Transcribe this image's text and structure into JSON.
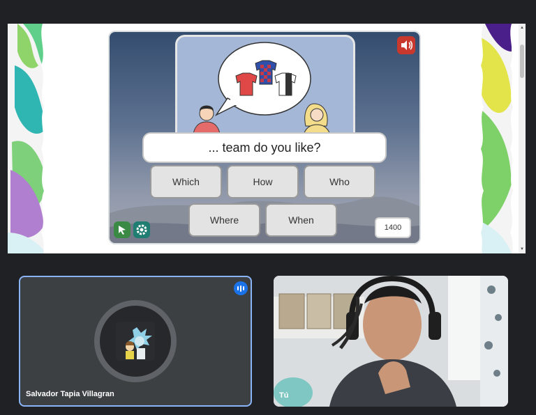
{
  "game": {
    "sentence": "... team do you like?",
    "options": [
      "Which",
      "How",
      "Who",
      "Where",
      "When"
    ],
    "score": "1400"
  },
  "participants": [
    {
      "name": "Salvador Tapia Villagran"
    },
    {
      "name": "Tú"
    }
  ],
  "icons": {
    "sound": "speaker-icon",
    "home": "home-icon",
    "settings": "gear-icon",
    "speaking": "audio-level-icon"
  },
  "colors": {
    "background": "#202124",
    "tile": "#3c4043",
    "active_border": "#8ab4f8",
    "speaking_badge": "#1a73e8",
    "sound_button": "#c9382c"
  }
}
